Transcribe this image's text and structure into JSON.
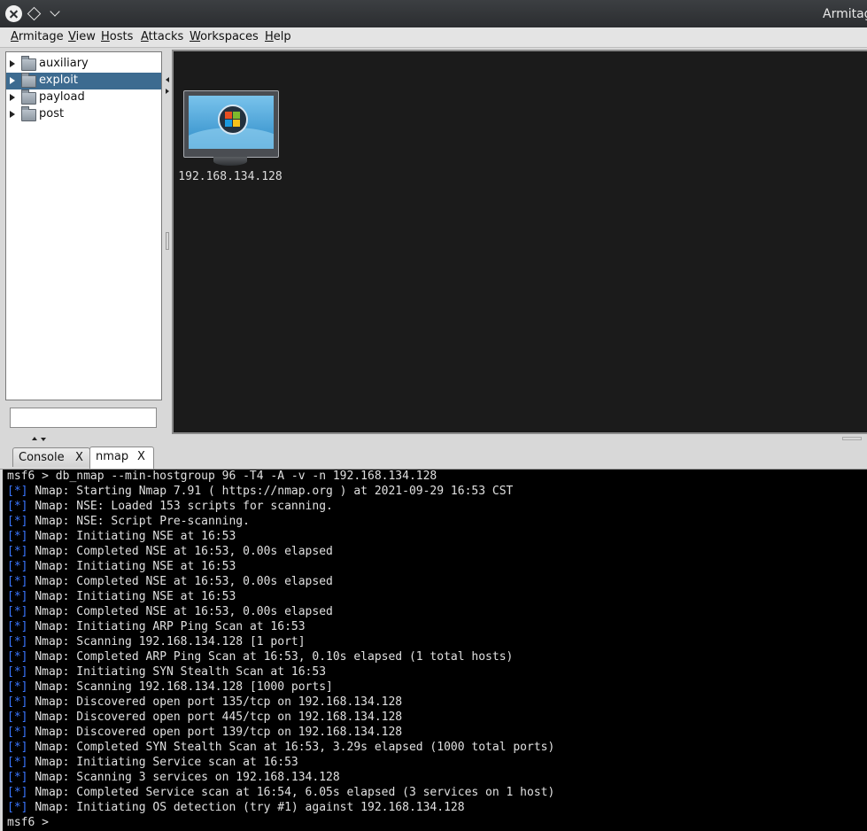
{
  "window": {
    "title": "Armitage"
  },
  "menu": {
    "items": [
      {
        "mnemonic": "A",
        "rest": "rmitage"
      },
      {
        "mnemonic": "V",
        "rest": "iew"
      },
      {
        "mnemonic": "H",
        "rest": "osts"
      },
      {
        "mnemonic": "A",
        "rest": "ttacks"
      },
      {
        "mnemonic": "W",
        "rest": "orkspaces"
      },
      {
        "mnemonic": "H",
        "rest": "elp"
      }
    ]
  },
  "module_tree": {
    "items": [
      "auxiliary",
      "exploit",
      "payload",
      "post"
    ],
    "selected": "exploit"
  },
  "module_search": {
    "value": ""
  },
  "hosts": [
    {
      "ip": "192.168.134.128",
      "os_icon": "windows-monitor-icon"
    }
  ],
  "tabs": [
    {
      "label": "Console",
      "close": "X"
    },
    {
      "label": "nmap",
      "close": "X"
    }
  ],
  "active_tab": "nmap",
  "console": {
    "marker": "[*]",
    "lines": [
      "msf6 > db_nmap --min-hostgroup 96 -T4 -A -v -n 192.168.134.128",
      "Nmap: Starting Nmap 7.91 ( https://nmap.org ) at 2021-09-29 16:53 CST",
      "Nmap: NSE: Loaded 153 scripts for scanning.",
      "Nmap: NSE: Script Pre-scanning.",
      "Nmap: Initiating NSE at 16:53",
      "Nmap: Completed NSE at 16:53, 0.00s elapsed",
      "Nmap: Initiating NSE at 16:53",
      "Nmap: Completed NSE at 16:53, 0.00s elapsed",
      "Nmap: Initiating NSE at 16:53",
      "Nmap: Completed NSE at 16:53, 0.00s elapsed",
      "Nmap: Initiating ARP Ping Scan at 16:53",
      "Nmap: Scanning 192.168.134.128 [1 port]",
      "Nmap: Completed ARP Ping Scan at 16:53, 0.10s elapsed (1 total hosts)",
      "Nmap: Initiating SYN Stealth Scan at 16:53",
      "Nmap: Scanning 192.168.134.128 [1000 ports]",
      "Nmap: Discovered open port 135/tcp on 192.168.134.128",
      "Nmap: Discovered open port 445/tcp on 192.168.134.128",
      "Nmap: Discovered open port 139/tcp on 192.168.134.128",
      "Nmap: Completed SYN Stealth Scan at 16:53, 3.29s elapsed (1000 total ports)",
      "Nmap: Initiating Service scan at 16:53",
      "Nmap: Scanning 3 services on 192.168.134.128",
      "Nmap: Completed Service scan at 16:54, 6.05s elapsed (3 services on 1 host)",
      "Nmap: Initiating OS detection (try #1) against 192.168.134.128"
    ],
    "prompt": "msf6 > "
  },
  "colors": {
    "selection": "#3d6b90",
    "console_bg": "#000000",
    "marker": "#3a76ff",
    "graph_bg": "#1b1b1b"
  }
}
